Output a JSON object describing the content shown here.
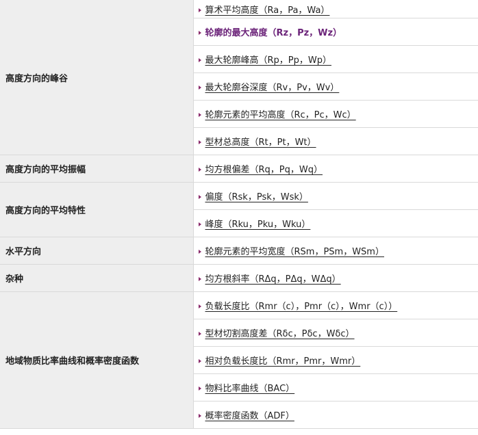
{
  "groups": [
    {
      "category": "高度方向的峰谷",
      "items": [
        {
          "label": "算术平均高度（Ra，Pa，Wa）",
          "active": false
        },
        {
          "label": "轮廓的最大高度（Rz，Pz，Wz）",
          "active": true
        },
        {
          "label": "最大轮廓峰高（Rp，Pp，Wp）",
          "active": false
        },
        {
          "label": "最大轮廓谷深度（Rv，Pv，Wv）",
          "active": false
        },
        {
          "label": "轮廓元素的平均高度（Rc，Pc，Wc）",
          "active": false
        },
        {
          "label": "型材总高度（Rt，Pt，Wt）",
          "active": false
        }
      ]
    },
    {
      "category": "高度方向的平均振幅",
      "items": [
        {
          "label": "均方根偏差（Rq，Pq，Wq）",
          "active": false
        }
      ]
    },
    {
      "category": "高度方向的平均特性",
      "items": [
        {
          "label": "偏度（Rsk，Psk，Wsk）",
          "active": false
        },
        {
          "label": "峰度（Rku，Pku，Wku）",
          "active": false
        }
      ]
    },
    {
      "category": "水平方向",
      "items": [
        {
          "label": "轮廓元素的平均宽度（RSm，PSm，WSm）",
          "active": false
        }
      ]
    },
    {
      "category": "杂种",
      "items": [
        {
          "label": "均方根斜率（RΔq，PΔq，WΔq）",
          "active": false
        }
      ]
    },
    {
      "category": "地域物质比率曲线和概率密度函数",
      "items": [
        {
          "label": "负载长度比（Rmr（c），Pmr（c），Wmr（c））",
          "active": false
        },
        {
          "label": "型材切割高度差（Rδc，Pδc，Wδc）",
          "active": false
        },
        {
          "label": "相对负载长度比（Rmr，Pmr，Wmr）",
          "active": false
        },
        {
          "label": "物料比率曲线（BAC）",
          "active": false
        },
        {
          "label": "概率密度函数（ADF）",
          "active": false
        }
      ]
    }
  ]
}
